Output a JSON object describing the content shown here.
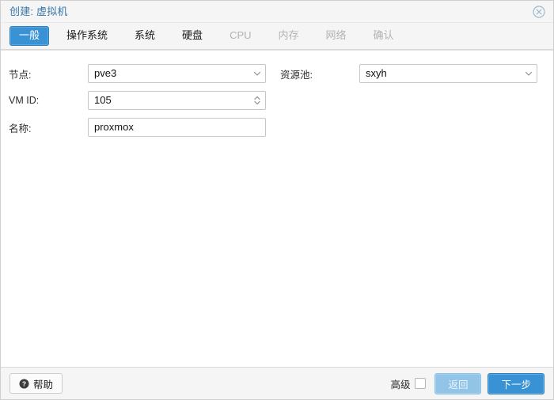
{
  "window": {
    "title": "创建: 虚拟机",
    "close_icon": "close-circle-icon"
  },
  "tabs": [
    {
      "label": "一般",
      "state": "active"
    },
    {
      "label": "操作系统",
      "state": "enabled"
    },
    {
      "label": "系统",
      "state": "enabled"
    },
    {
      "label": "硬盘",
      "state": "enabled"
    },
    {
      "label": "CPU",
      "state": "disabled"
    },
    {
      "label": "内存",
      "state": "disabled"
    },
    {
      "label": "网络",
      "state": "disabled"
    },
    {
      "label": "确认",
      "state": "disabled"
    }
  ],
  "form": {
    "left": [
      {
        "label": "节点:",
        "value": "pve3",
        "control": "combobox",
        "trigger_icon": "chevron-down-icon"
      },
      {
        "label": "VM ID:",
        "value": "105",
        "control": "spinner",
        "trigger_icon": "spinner-updown-icon"
      },
      {
        "label": "名称:",
        "value": "proxmox",
        "placeholder": "",
        "control": "textfield",
        "trigger_icon": ""
      }
    ],
    "right": [
      {
        "label": "资源池:",
        "value": "sxyh",
        "control": "combobox",
        "trigger_icon": "chevron-down-icon"
      }
    ]
  },
  "footer": {
    "help_label": "帮助",
    "help_icon": "question-circle-icon",
    "advanced_label": "高级",
    "advanced_checked": false,
    "back_label": "返回",
    "back_state": "disabled",
    "next_label": "下一步",
    "next_state": "enabled"
  },
  "colors": {
    "accent": "#3892d4",
    "accent_border": "#2f7fbb",
    "accent_disabled": "#92c4e8",
    "title": "#3a76a8",
    "chrome": "#f5f5f5",
    "border": "#d8d8d8",
    "text": "#1b1b1b",
    "text_disabled": "#b3b3b3"
  }
}
